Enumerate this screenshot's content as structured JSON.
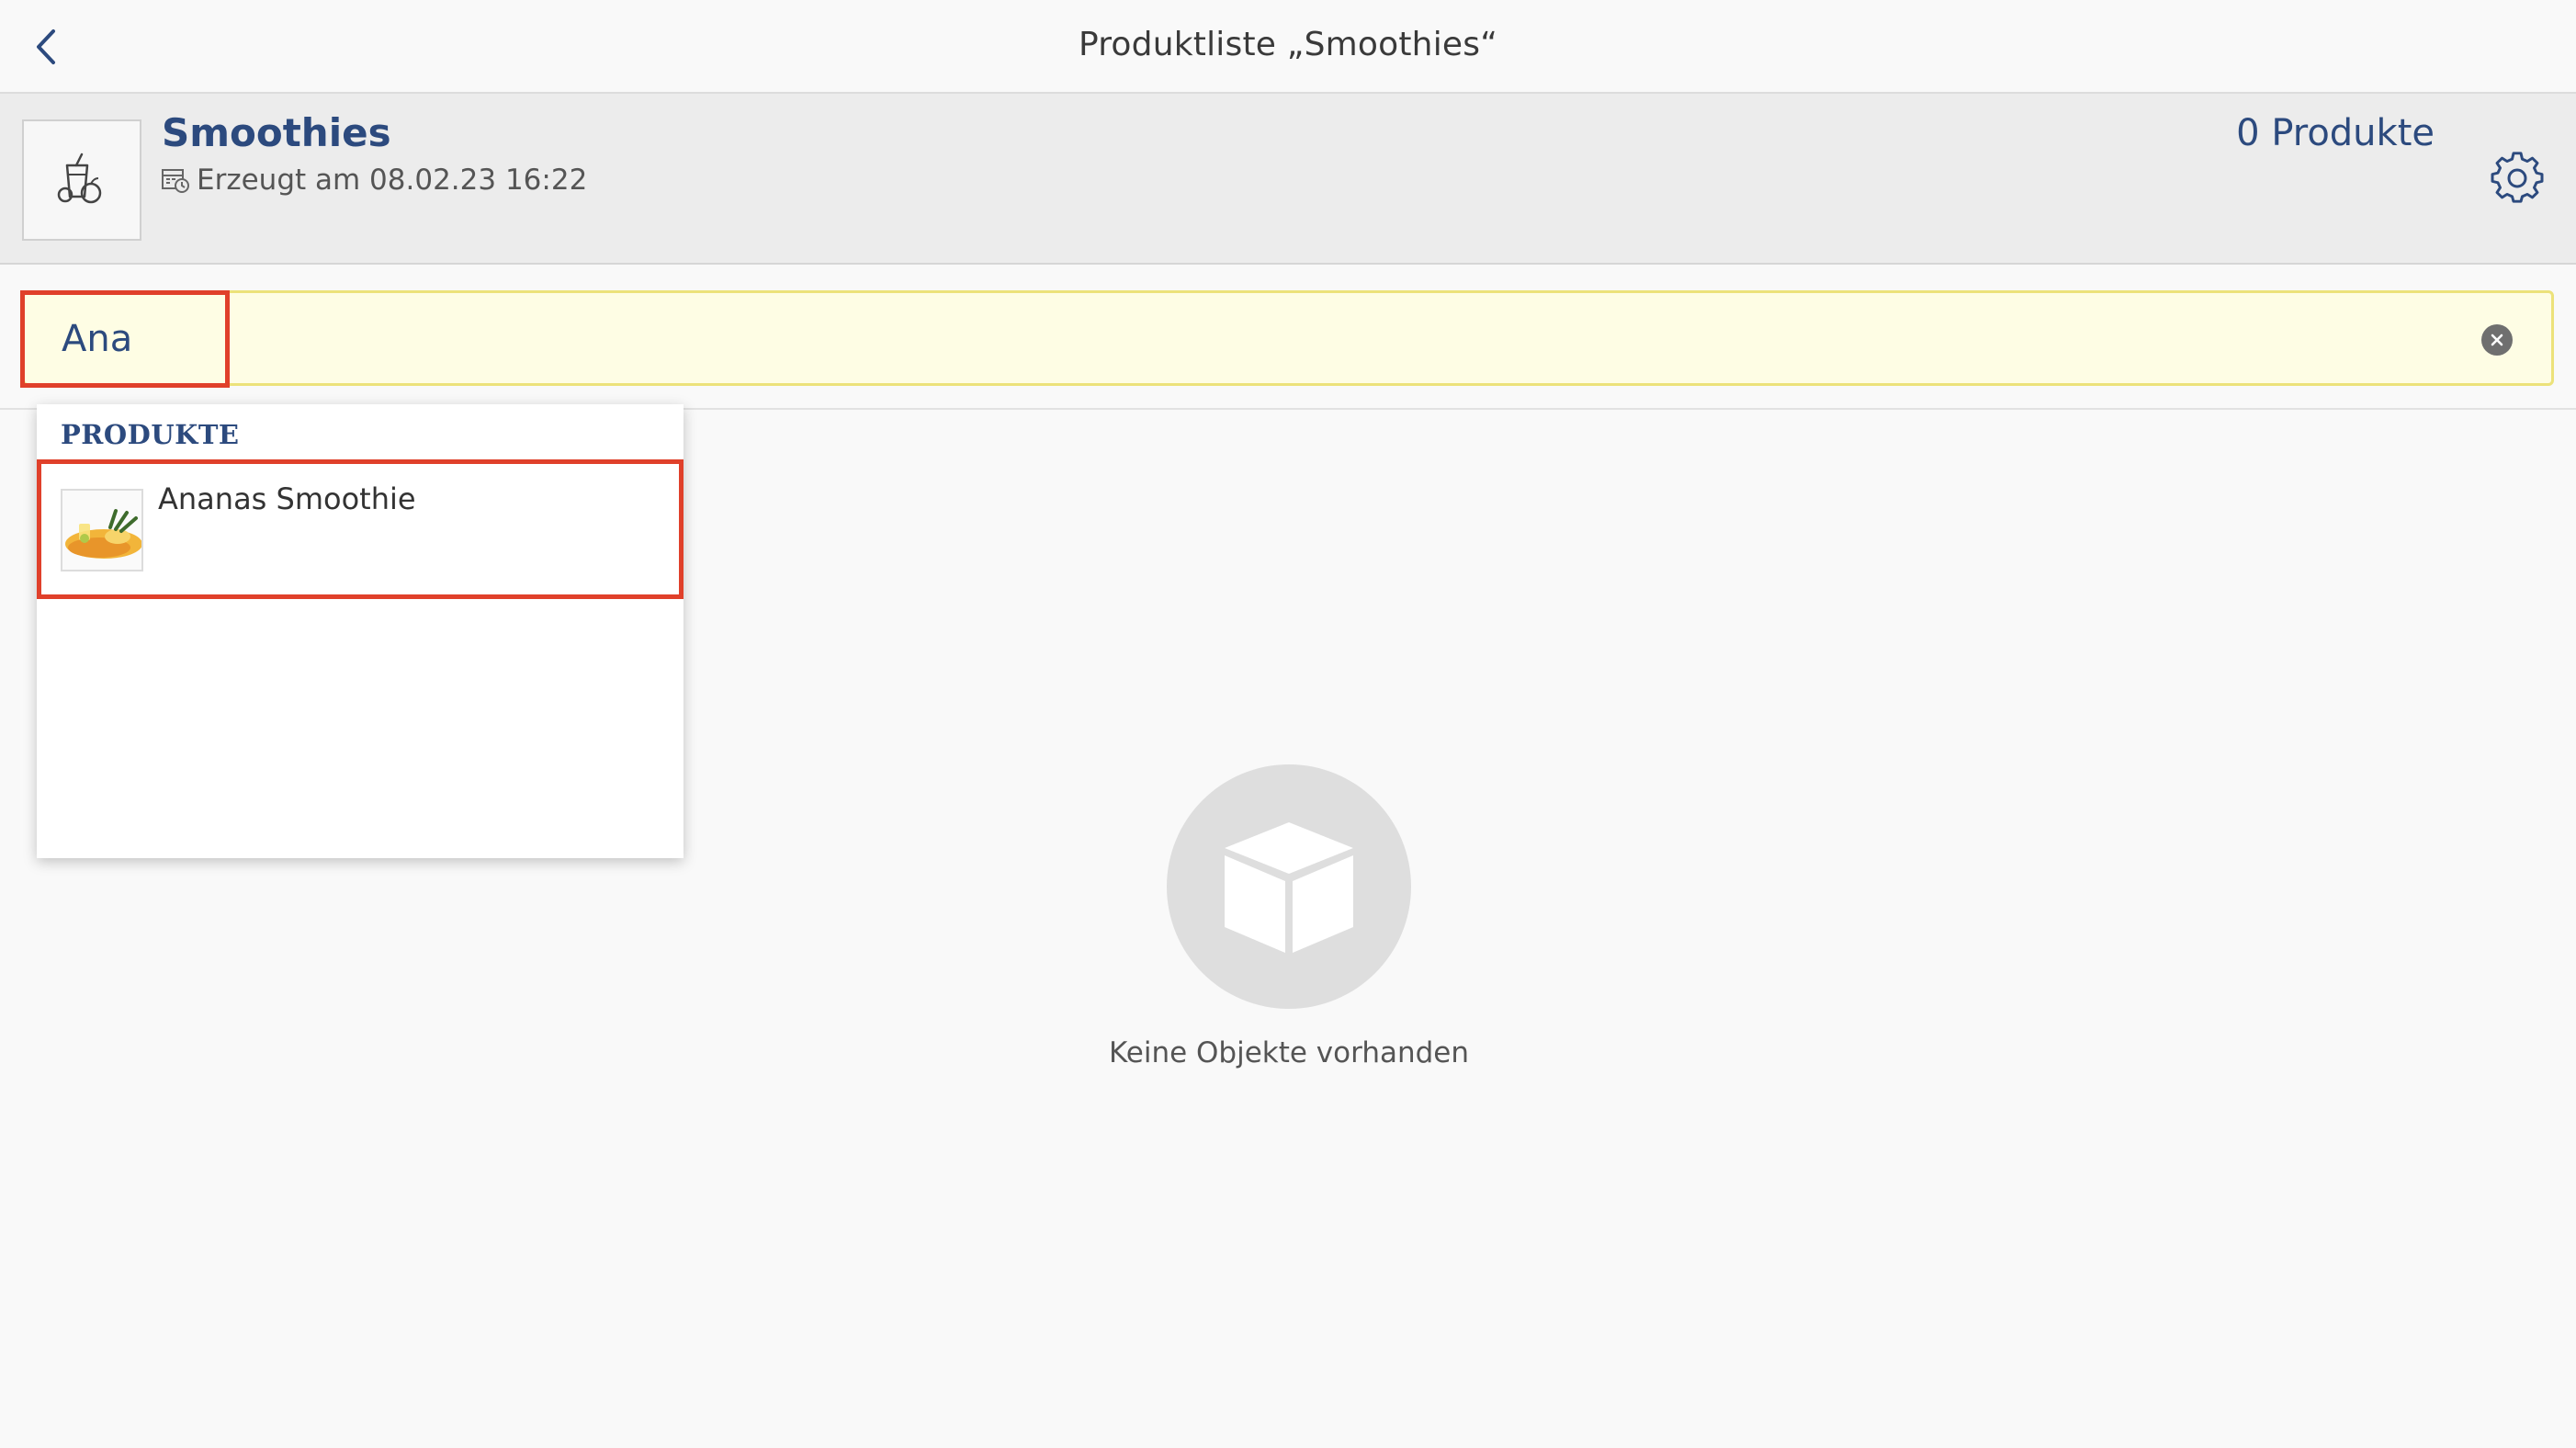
{
  "navbar": {
    "title": "Produktliste „Smoothies“",
    "back_icon": "chevron-left-icon"
  },
  "list": {
    "name": "Smoothies",
    "created_label": "Erzeugt am 08.02.23 16:22",
    "product_count": "0 Produkte",
    "thumb_icon": "smoothie-icon",
    "settings_icon": "gear-icon"
  },
  "search": {
    "value": "Ana",
    "placeholder": "",
    "clear_icon": "clear-icon"
  },
  "dropdown": {
    "heading": "PRODUKTE",
    "results": [
      {
        "name": "Ananas Smoothie"
      }
    ]
  },
  "empty_state": {
    "message": "Keine Objekte vorhanden",
    "icon": "box-icon"
  },
  "colors": {
    "accent": "#2c4a7e",
    "highlight": "#e0402a",
    "search_bg": "#fefde4"
  }
}
